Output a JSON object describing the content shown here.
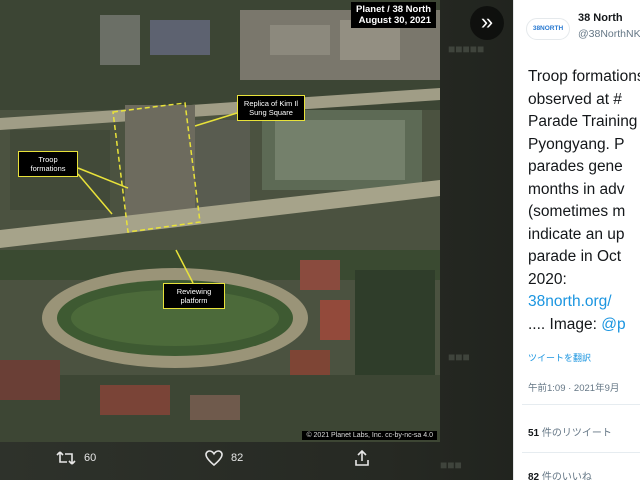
{
  "image": {
    "caption_line1": "Planet / 38 North",
    "caption_line2": "August 30, 2021",
    "copyright": "© 2021 Planet Labs, Inc. cc-by-nc-sa 4.0",
    "annotations": {
      "troop": "Troop formations",
      "replica": "Replica of Kim Il Sung Square",
      "reviewing": "Reviewing platform"
    }
  },
  "lightbox": {
    "chevron": "»"
  },
  "actions": {
    "retweets": "60",
    "likes": "82"
  },
  "tweet": {
    "account_name": "38 North",
    "account_handle": "@38NorthNK",
    "logo_text": "38NORTH",
    "lines": [
      "Troop formations",
      "observed at #",
      "Parade Training",
      "Pyongyang. P",
      "parades gene",
      "months in adv",
      "(sometimes m",
      "indicate an up",
      "parade in Oct",
      "2020:"
    ],
    "link1": "38north.org/",
    "image_credit_prefix": ".... Image: ",
    "image_credit_handle": "@p",
    "translate": "ツイートを翻訳",
    "timestamp": "午前1:09 · 2021年9月",
    "retweet_count": "51",
    "retweet_label": " 件のリツイート",
    "like_count": "82",
    "like_label": " 件のいいね"
  },
  "colors": {
    "link": "#1b95e0",
    "annotation_border": "#e8e23a"
  }
}
